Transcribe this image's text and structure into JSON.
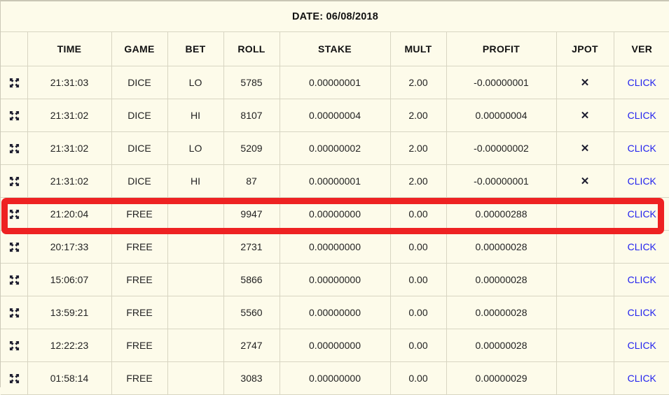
{
  "header": {
    "date_label": "DATE: 06/08/2018"
  },
  "columns": [
    {
      "key": "icon",
      "label": ""
    },
    {
      "key": "time",
      "label": "TIME"
    },
    {
      "key": "game",
      "label": "GAME"
    },
    {
      "key": "bet",
      "label": "BET"
    },
    {
      "key": "roll",
      "label": "ROLL"
    },
    {
      "key": "stake",
      "label": "STAKE"
    },
    {
      "key": "mult",
      "label": "MULT"
    },
    {
      "key": "profit",
      "label": "PROFIT"
    },
    {
      "key": "jpot",
      "label": "JPOT"
    },
    {
      "key": "ver",
      "label": "VER"
    }
  ],
  "colors": {
    "page_background": "#fdfbea",
    "cell_border": "#d8d5c2",
    "profit_positive": "#2f7a2f",
    "profit_negative": "#ff4d55",
    "link": "#2222ee",
    "highlight_box": "#ee2222",
    "icon": "#1c1c2e"
  },
  "icons": {
    "row_expand": "expand-arrows-icon",
    "jpot_mark": "cross-x-icon"
  },
  "link_label": "CLICK",
  "jpot_mark": "✕",
  "highlight": {
    "row_index": 4,
    "color": "#ee2222"
  },
  "rows": [
    {
      "time": "21:31:03",
      "game": "DICE",
      "bet": "LO",
      "roll": "5785",
      "stake": "0.00000001",
      "mult": "2.00",
      "profit": "-0.00000001",
      "profit_sign": "neg",
      "jpot": "✕",
      "ver": "CLICK"
    },
    {
      "time": "21:31:02",
      "game": "DICE",
      "bet": "HI",
      "roll": "8107",
      "stake": "0.00000004",
      "mult": "2.00",
      "profit": "0.00000004",
      "profit_sign": "pos",
      "jpot": "✕",
      "ver": "CLICK"
    },
    {
      "time": "21:31:02",
      "game": "DICE",
      "bet": "LO",
      "roll": "5209",
      "stake": "0.00000002",
      "mult": "2.00",
      "profit": "-0.00000002",
      "profit_sign": "neg",
      "jpot": "✕",
      "ver": "CLICK"
    },
    {
      "time": "21:31:02",
      "game": "DICE",
      "bet": "HI",
      "roll": "87",
      "stake": "0.00000001",
      "mult": "2.00",
      "profit": "-0.00000001",
      "profit_sign": "neg",
      "jpot": "✕",
      "ver": "CLICK"
    },
    {
      "time": "21:20:04",
      "game": "FREE",
      "bet": "",
      "roll": "9947",
      "stake": "0.00000000",
      "mult": "0.00",
      "profit": "0.00000288",
      "profit_sign": "pos",
      "jpot": "",
      "ver": "CLICK"
    },
    {
      "time": "20:17:33",
      "game": "FREE",
      "bet": "",
      "roll": "2731",
      "stake": "0.00000000",
      "mult": "0.00",
      "profit": "0.00000028",
      "profit_sign": "pos",
      "jpot": "",
      "ver": "CLICK"
    },
    {
      "time": "15:06:07",
      "game": "FREE",
      "bet": "",
      "roll": "5866",
      "stake": "0.00000000",
      "mult": "0.00",
      "profit": "0.00000028",
      "profit_sign": "pos",
      "jpot": "",
      "ver": "CLICK"
    },
    {
      "time": "13:59:21",
      "game": "FREE",
      "bet": "",
      "roll": "5560",
      "stake": "0.00000000",
      "mult": "0.00",
      "profit": "0.00000028",
      "profit_sign": "pos",
      "jpot": "",
      "ver": "CLICK"
    },
    {
      "time": "12:22:23",
      "game": "FREE",
      "bet": "",
      "roll": "2747",
      "stake": "0.00000000",
      "mult": "0.00",
      "profit": "0.00000028",
      "profit_sign": "pos",
      "jpot": "",
      "ver": "CLICK"
    },
    {
      "time": "01:58:14",
      "game": "FREE",
      "bet": "",
      "roll": "3083",
      "stake": "0.00000000",
      "mult": "0.00",
      "profit": "0.00000029",
      "profit_sign": "pos",
      "jpot": "",
      "ver": "CLICK"
    }
  ]
}
